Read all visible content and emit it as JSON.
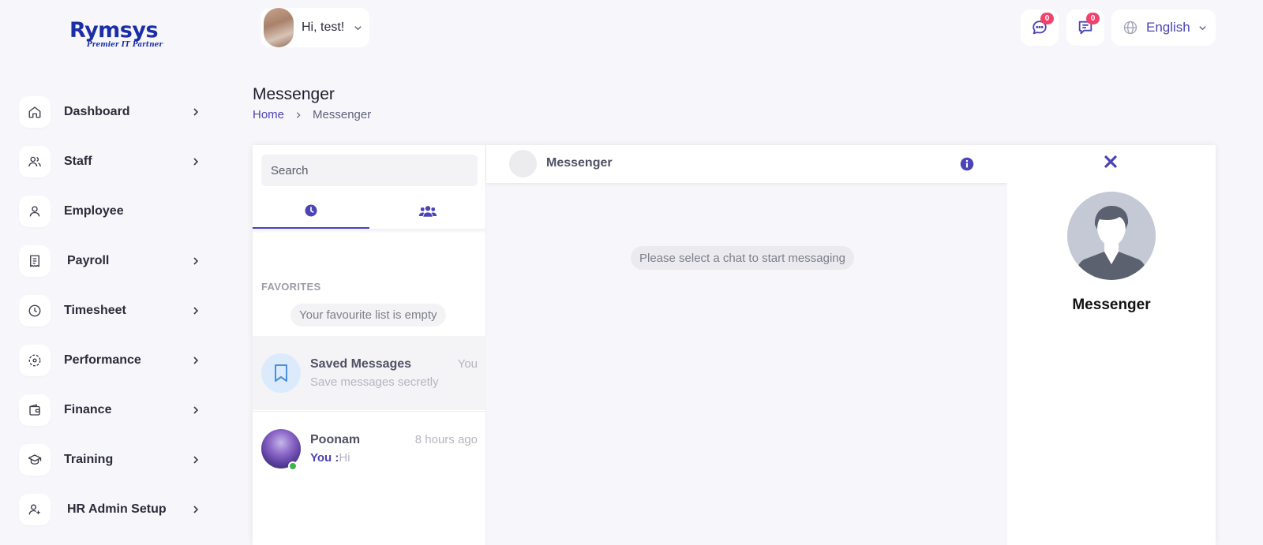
{
  "brand": {
    "name": "Rymsys",
    "tagline": "Premier IT Partner",
    "color": "#1c2ea6"
  },
  "sidebar": {
    "items": [
      {
        "label": "Dashboard",
        "icon": "home-icon",
        "has_chevron": true
      },
      {
        "label": "Staff",
        "icon": "users-icon",
        "has_chevron": true
      },
      {
        "label": "Employee",
        "icon": "user-icon",
        "has_chevron": false
      },
      {
        "label": "Payroll",
        "icon": "receipt-icon",
        "has_chevron": true
      },
      {
        "label": "Timesheet",
        "icon": "clock-icon",
        "has_chevron": true
      },
      {
        "label": "Performance",
        "icon": "target-icon",
        "has_chevron": true
      },
      {
        "label": "Finance",
        "icon": "wallet-icon",
        "has_chevron": true
      },
      {
        "label": "Training",
        "icon": "graduation-cap-icon",
        "has_chevron": true
      },
      {
        "label": "HR Admin Setup",
        "icon": "user-plus-icon",
        "has_chevron": true
      }
    ]
  },
  "header": {
    "greeting": "Hi, test!",
    "messages_badge": "0",
    "notifications_badge": "0",
    "language": "English",
    "accent_color": "#4b44b5",
    "badge_color": "#f1416c"
  },
  "page": {
    "title": "Messenger",
    "breadcrumb": {
      "home": "Home",
      "current": "Messenger"
    }
  },
  "messenger": {
    "search_placeholder": "Search",
    "tabs": [
      {
        "name": "recent",
        "icon": "clock-icon",
        "active": true
      },
      {
        "name": "groups",
        "icon": "users-icon",
        "active": false
      }
    ],
    "favorites_title": "FAVORITES",
    "favorites_empty": "Your favourite list is empty",
    "contacts": [
      {
        "name": "Saved Messages",
        "time": "You",
        "subtitle": "Save messages secretly"
      },
      {
        "name": "Poonam",
        "time": "8 hours ago",
        "you_prefix": "You :",
        "last_message": "Hi",
        "online": true
      }
    ],
    "chat_title": "Messenger",
    "empty_chat": "Please select a chat to start messaging",
    "info_name": "Messenger"
  }
}
